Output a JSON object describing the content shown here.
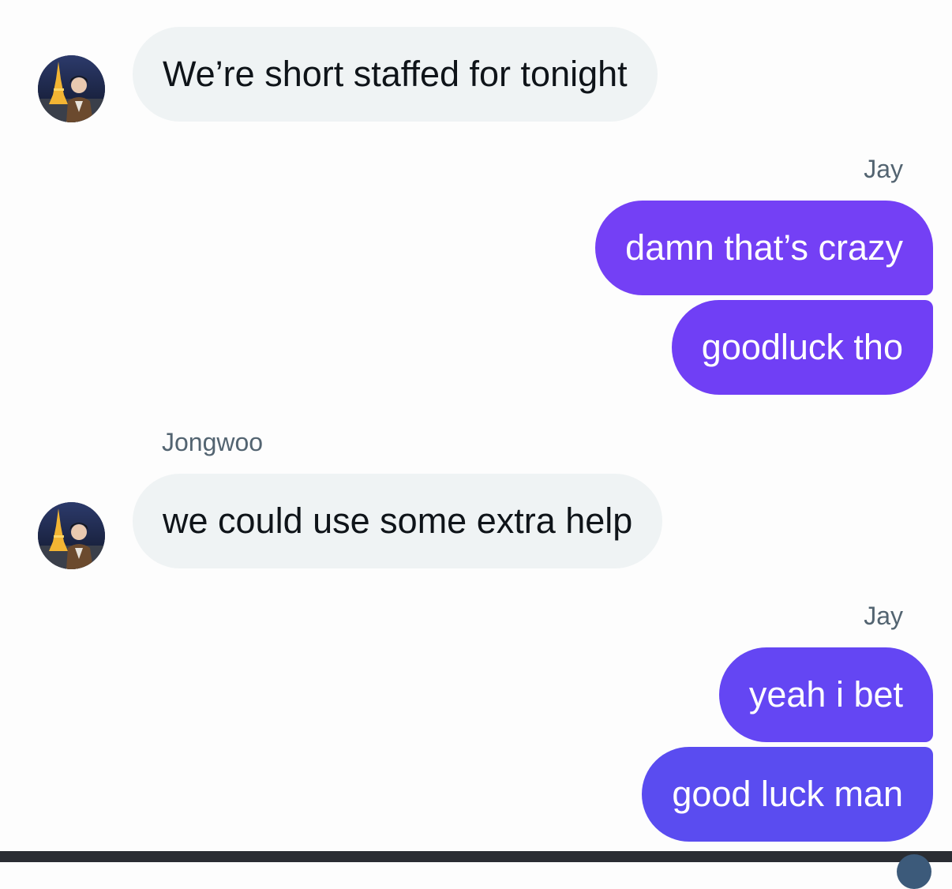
{
  "conversation": {
    "messages": [
      {
        "sender": "",
        "text": "We’re short staffed for tonight",
        "direction": "incoming"
      },
      {
        "sender": "Jay",
        "text": "damn that’s crazy",
        "direction": "outgoing"
      },
      {
        "sender": "",
        "text": "goodluck tho",
        "direction": "outgoing"
      },
      {
        "sender": "Jongwoo",
        "text": "we could use some extra help",
        "direction": "incoming"
      },
      {
        "sender": "Jay",
        "text": "yeah i bet",
        "direction": "outgoing"
      },
      {
        "sender": "",
        "text": "good luck man",
        "direction": "outgoing"
      }
    ],
    "avatar_icon": "profile-photo-eiffel-tower-night"
  },
  "colors": {
    "incoming_bubble": "#eff3f4",
    "outgoing_gradient_top": "#7a3ff5",
    "outgoing_gradient_bottom": "#5a4cf0",
    "sender_label": "#536471"
  }
}
